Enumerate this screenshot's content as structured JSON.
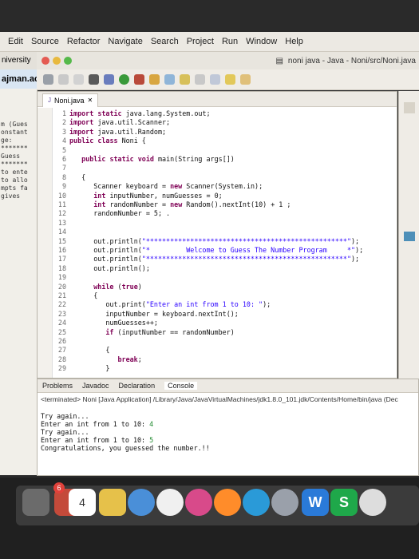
{
  "menu": [
    "Edit",
    "Source",
    "Refactor",
    "Navigate",
    "Search",
    "Project",
    "Run",
    "Window",
    "Help"
  ],
  "left_panel": {
    "header": "niversity",
    "header2": "ajman.ac",
    "lines": [
      "m (Gues",
      "onstant",
      "ge:",
      "*******",
      "Guess",
      "*******",
      "to ente",
      "to allo",
      "mpts fa",
      "gives"
    ]
  },
  "window": {
    "title": "noni java - Java - Noni/src/Noni.java"
  },
  "editor": {
    "tab_label": "Noni.java",
    "tab_close": "✕",
    "lines": [
      {
        "n": "1",
        "t": "import static java.lang.System.out;"
      },
      {
        "n": "2",
        "t": "import java.util.Scanner;"
      },
      {
        "n": "3",
        "t": "import java.util.Random;"
      },
      {
        "n": "4",
        "t": "public class Noni {"
      },
      {
        "n": "5",
        "t": ""
      },
      {
        "n": "6",
        "t": "   public static void main(String args[])"
      },
      {
        "n": "7",
        "t": ""
      },
      {
        "n": "8",
        "t": "   {"
      },
      {
        "n": "9",
        "t": "      Scanner keyboard = new Scanner(System.in);"
      },
      {
        "n": "10",
        "t": "      int inputNumber, numGuesses = 0;"
      },
      {
        "n": "11",
        "t": "      int randomNumber = new Random().nextInt(10) + 1 ;"
      },
      {
        "n": "12",
        "t": "      randomNumber = 5; ."
      },
      {
        "n": "13",
        "t": ""
      },
      {
        "n": "14",
        "t": ""
      },
      {
        "n": "15",
        "t": "      out.println(\"**************************************************\");"
      },
      {
        "n": "16",
        "t": "      out.println(\"*         Welcome to Guess The Number Program     *\");"
      },
      {
        "n": "17",
        "t": "      out.println(\"**************************************************\");"
      },
      {
        "n": "18",
        "t": "      out.println();"
      },
      {
        "n": "19",
        "t": ""
      },
      {
        "n": "20",
        "t": "      while (true)"
      },
      {
        "n": "21",
        "t": "      {"
      },
      {
        "n": "22",
        "t": "         out.print(\"Enter an int from 1 to 10: \");"
      },
      {
        "n": "23",
        "t": "         inputNumber = keyboard.nextInt();"
      },
      {
        "n": "24",
        "t": "         numGuesses++;"
      },
      {
        "n": "25",
        "t": "         if (inputNumber == randomNumber)"
      },
      {
        "n": "26",
        "t": ""
      },
      {
        "n": "27",
        "t": "         {"
      },
      {
        "n": "28",
        "t": "            break;"
      },
      {
        "n": "29",
        "t": "         }"
      }
    ]
  },
  "console": {
    "tabs": [
      "Problems",
      "Javadoc",
      "Declaration",
      "Console"
    ],
    "terminated": "<terminated> Noni [Java Application] /Library/Java/JavaVirtualMachines/jdk1.8.0_101.jdk/Contents/Home/bin/java (Dec",
    "output": [
      {
        "text": "Try again...",
        "input": ""
      },
      {
        "text": "Enter an int from 1 to 10: ",
        "input": "4"
      },
      {
        "text": "",
        "input": ""
      },
      {
        "text": "Try again...",
        "input": ""
      },
      {
        "text": "Enter an int from 1 to 10: ",
        "input": "5"
      },
      {
        "text": "Congratulations, you guessed the number.!!",
        "input": ""
      }
    ]
  },
  "dock": {
    "calendar_day": "4",
    "badge": "6"
  },
  "colors": {
    "keyword": "#7f0055",
    "string": "#2a00ff",
    "console_input": "#1f8a2f"
  }
}
